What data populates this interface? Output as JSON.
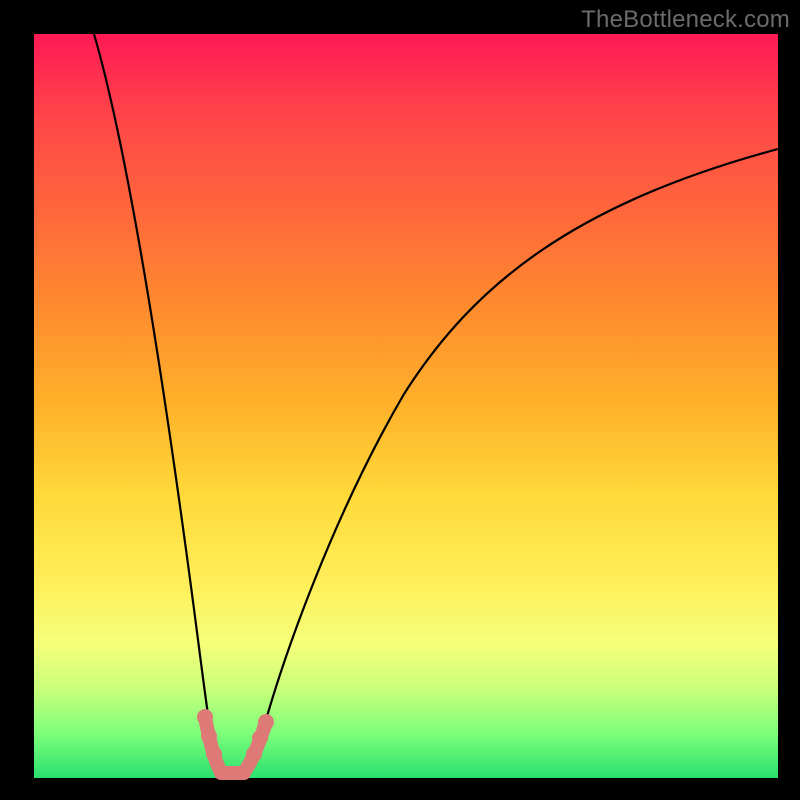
{
  "watermark": "TheBottleneck.com",
  "chart_data": {
    "type": "line",
    "title": "",
    "xlabel": "",
    "ylabel": "",
    "xlim": [
      0,
      100
    ],
    "ylim": [
      0,
      100
    ],
    "grid": false,
    "series": [
      {
        "name": "bottleneck-curve",
        "color": "#000000",
        "x": [
          8,
          10,
          12,
          14,
          16,
          18,
          20,
          21,
          22,
          22.6,
          23,
          23.5,
          24,
          25,
          26,
          27,
          28,
          31,
          36,
          42,
          50,
          60,
          72,
          86,
          100
        ],
        "y": [
          100,
          90,
          78,
          66,
          54,
          42,
          30,
          22,
          12,
          5,
          1,
          0,
          1,
          3,
          7,
          13,
          19,
          32,
          48,
          58,
          66,
          73,
          78,
          82,
          85
        ]
      }
    ],
    "highlight": {
      "name": "optimal-zone",
      "color": "#dd7a78",
      "x_range": [
        22,
        25.5
      ],
      "y_range": [
        0,
        6
      ]
    },
    "background_gradient": {
      "top_color": "#ff1a55",
      "bottom_color": "#29e06e"
    }
  }
}
